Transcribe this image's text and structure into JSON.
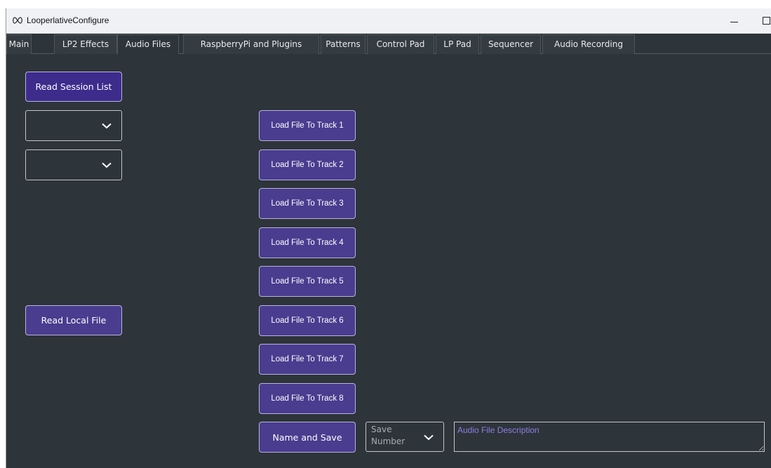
{
  "window": {
    "title": "LooperlativeConfigure"
  },
  "tabs": [
    {
      "label": "Main"
    },
    {
      "label": "LP2 Effects"
    },
    {
      "label": "Audio Files"
    },
    {
      "label": "RaspberryPi and Plugins"
    },
    {
      "label": "Patterns"
    },
    {
      "label": "Control Pad"
    },
    {
      "label": "LP Pad"
    },
    {
      "label": "Sequencer"
    },
    {
      "label": "Audio Recording"
    }
  ],
  "active_tab": "Audio Files",
  "left": {
    "read_session_label": "Read Session List",
    "read_local_label": "Read Local File"
  },
  "tracks": [
    {
      "label": "Load File To Track 1"
    },
    {
      "label": "Load File To Track 2"
    },
    {
      "label": "Load File To Track 3"
    },
    {
      "label": "Load File To Track 4"
    },
    {
      "label": "Load File To Track 5"
    },
    {
      "label": "Load File To Track 6"
    },
    {
      "label": "Load File To Track 7"
    },
    {
      "label": "Load File To Track 8"
    }
  ],
  "save": {
    "button_label": "Name and Save",
    "number_placeholder_line1": "Save",
    "number_placeholder_line2": "Number",
    "description_placeholder": "Audio File Description"
  },
  "colors": {
    "background": "#2d343a",
    "button": "#4a3c8f",
    "button_active": "#3d2c8c",
    "placeholder_accent": "#8c7fe0"
  },
  "icons": {
    "app": "infinity-loop-icon",
    "dropdown": "chevron-down-icon"
  }
}
